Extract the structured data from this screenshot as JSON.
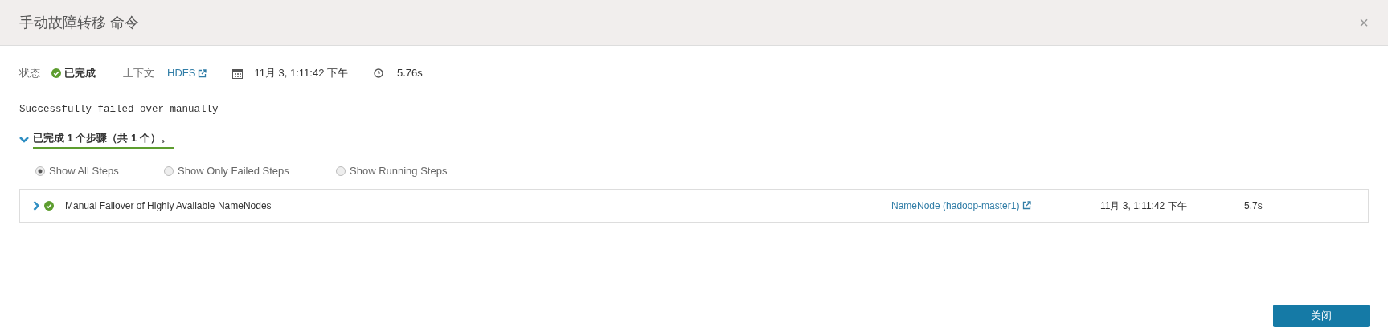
{
  "dialog": {
    "title": "手动故障转移 命令",
    "close": "×"
  },
  "summary": {
    "status_label": "状态",
    "status": "已完成",
    "context_label": "上下文",
    "context": "HDFS",
    "date": "11月 3, 1:11:42 下午",
    "duration": "5.76s"
  },
  "message": "Successfully failed over manually",
  "steps_heading": {
    "text": "已完成 1 个步骤（共 1 个）。",
    "expanded": true
  },
  "filters": [
    {
      "label": "Show All Steps",
      "selected": true
    },
    {
      "label": "Show Only Failed Steps",
      "selected": false
    },
    {
      "label": "Show Running Steps",
      "selected": false
    }
  ],
  "steps": [
    {
      "expanded": false,
      "name": "Manual Failover of Highly Available NameNodes",
      "role": "NameNode (hadoop-master1)",
      "time": "11月 3, 1:11:42 下午",
      "duration": "5.7s"
    }
  ],
  "buttons": [
    "关闭"
  ]
}
